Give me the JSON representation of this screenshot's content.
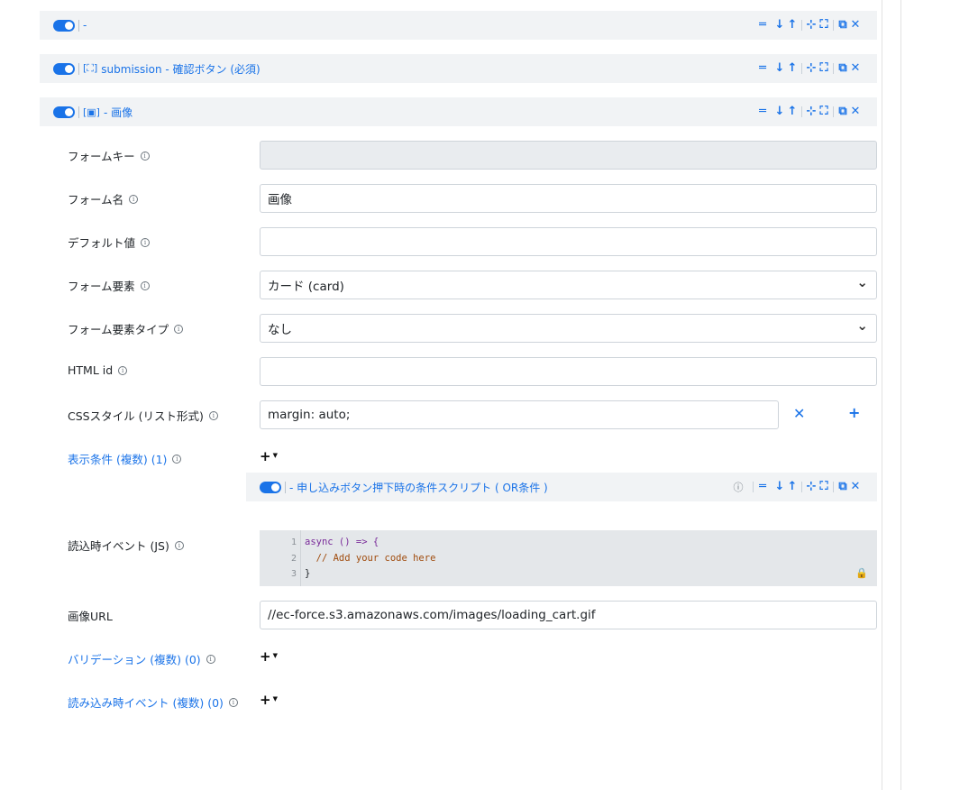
{
  "bars": [
    {
      "title": "-",
      "icon": ""
    },
    {
      "title": "submission - 確認ボタン (必須)",
      "icon": "[⛶]"
    },
    {
      "title": "- 画像",
      "icon": "[▣]"
    }
  ],
  "fields": {
    "form_key": {
      "label": "フォームキー",
      "value": ""
    },
    "form_name": {
      "label": "フォーム名",
      "value": "画像"
    },
    "default_value": {
      "label": "デフォルト値",
      "value": ""
    },
    "form_element": {
      "label": "フォーム要素",
      "value": "カード (card)"
    },
    "form_element_type": {
      "label": "フォーム要素タイプ",
      "value": "なし"
    },
    "html_id": {
      "label": "HTML id",
      "value": ""
    },
    "css_style": {
      "label": "CSSスタイル (リスト形式)",
      "value": "margin: auto;"
    },
    "display_conditions": {
      "label": "表示条件 (複数) (1)"
    },
    "condition_item": {
      "title": "- 申し込みボタン押下時の条件スクリプト ( OR条件 )"
    },
    "load_event": {
      "label": "読込時イベント (JS)",
      "code_lines": [
        "async () => {",
        "  // Add your code here",
        "}"
      ],
      "line_numbers": [
        "1",
        "2",
        "3"
      ]
    },
    "image_url": {
      "label": "画像URL",
      "value": "//ec-force.s3.amazonaws.com/images/loading_cart.gif"
    },
    "validations": {
      "label": "バリデーション (複数) (0)"
    },
    "load_events": {
      "label": "読み込み時イベント (複数) (0)"
    }
  },
  "icons": {
    "move": "drag-handle-icon",
    "down": "arrow-down-icon",
    "up": "arrow-up-icon",
    "collapse": "collapse-icon",
    "expand": "expand-icon",
    "copy": "copy-icon",
    "close": "close-icon",
    "info": "info-icon",
    "lock": "lock-icon",
    "add": "plus-icon"
  },
  "colors": {
    "accent": "#1a73e8",
    "bar_bg": "#f1f3f5",
    "code_bg": "#e4e7ea"
  }
}
